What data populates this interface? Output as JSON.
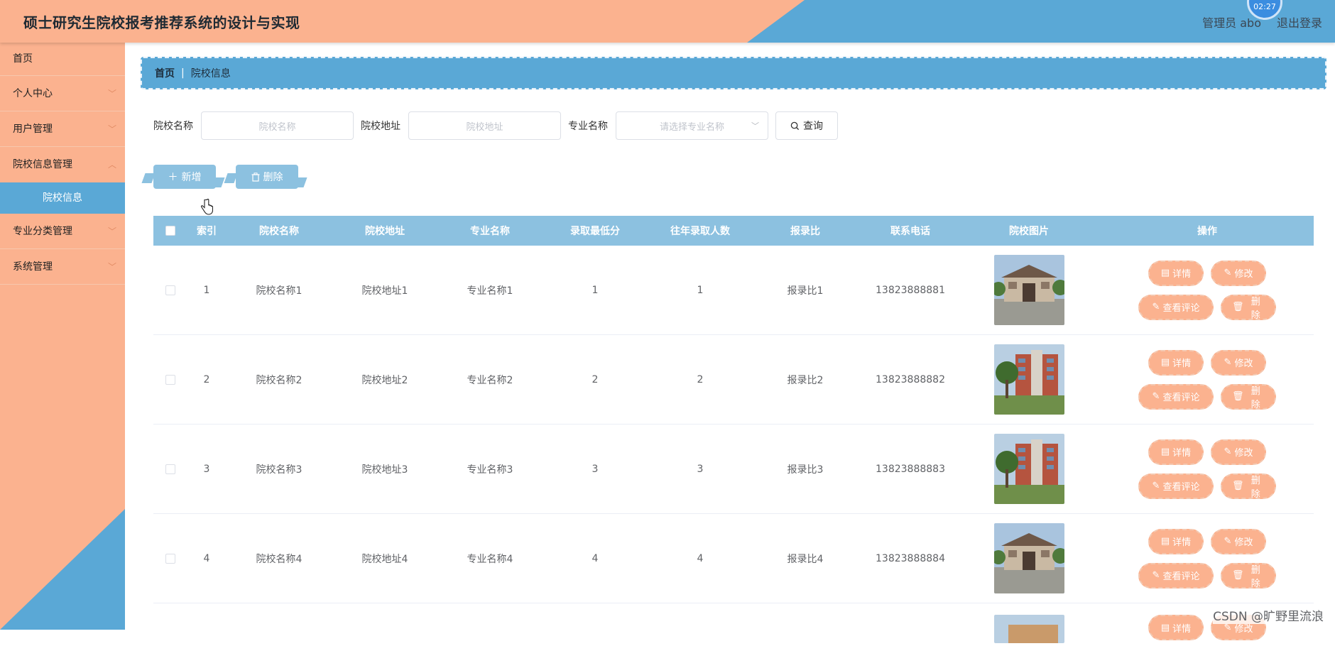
{
  "header": {
    "title": "硕士研究生院校报考推荐系统的设计与实现",
    "admin_label": "管理员 abo",
    "logout_label": "退出登录",
    "clock": "02:27"
  },
  "sidebar": {
    "items": [
      {
        "label": "首页"
      },
      {
        "label": "个人中心"
      },
      {
        "label": "用户管理"
      },
      {
        "label": "院校信息管理"
      },
      {
        "label": "院校信息"
      },
      {
        "label": "专业分类管理"
      },
      {
        "label": "系统管理"
      }
    ]
  },
  "breadcrumb": {
    "home": "首页",
    "sep": "|",
    "current": "院校信息"
  },
  "search": {
    "school_label": "院校名称",
    "school_placeholder": "院校名称",
    "address_label": "院校地址",
    "address_placeholder": "院校地址",
    "major_label": "专业名称",
    "major_placeholder": "请选择专业名称",
    "query_label": "查询"
  },
  "actions": {
    "add_label": "新增",
    "delete_label": "删除"
  },
  "table": {
    "headers": [
      "索引",
      "院校名称",
      "院校地址",
      "专业名称",
      "录取最低分",
      "往年录取人数",
      "报录比",
      "联系电话",
      "院校图片",
      "操作"
    ],
    "rows": [
      {
        "index": "1",
        "name": "院校名称1",
        "address": "院校地址1",
        "major": "专业名称1",
        "min_score": "1",
        "admitted": "1",
        "ratio": "报录比1",
        "phone": "13823888881"
      },
      {
        "index": "2",
        "name": "院校名称2",
        "address": "院校地址2",
        "major": "专业名称2",
        "min_score": "2",
        "admitted": "2",
        "ratio": "报录比2",
        "phone": "13823888882"
      },
      {
        "index": "3",
        "name": "院校名称3",
        "address": "院校地址3",
        "major": "专业名称3",
        "min_score": "3",
        "admitted": "3",
        "ratio": "报录比3",
        "phone": "13823888883"
      },
      {
        "index": "4",
        "name": "院校名称4",
        "address": "院校地址4",
        "major": "专业名称4",
        "min_score": "4",
        "admitted": "4",
        "ratio": "报录比4",
        "phone": "13823888884"
      }
    ],
    "op_labels": {
      "detail": "详情",
      "edit": "修改",
      "comments": "查看评论",
      "delete": "删除"
    }
  },
  "watermark": "CSDN @旷野里流浪",
  "colors": {
    "peach": "#fbb28f",
    "blue": "#5aa8d6",
    "light_blue": "#8cc1e0"
  }
}
